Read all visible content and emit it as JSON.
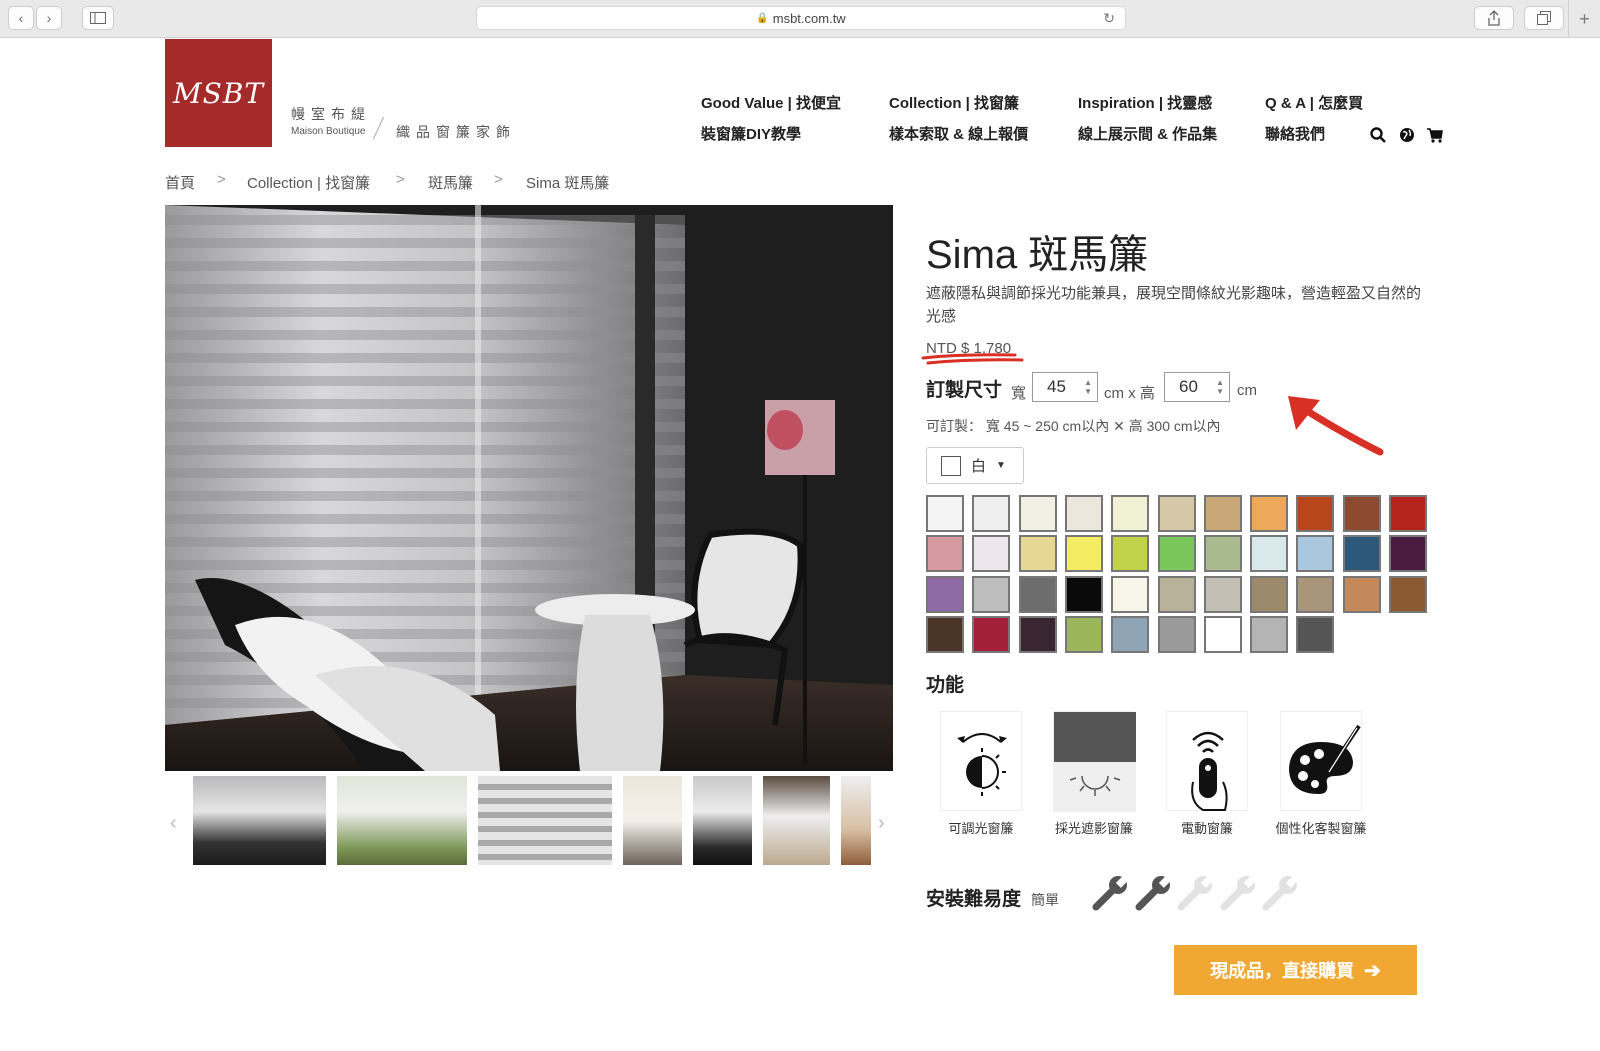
{
  "browser": {
    "url": "msbt.com.tw",
    "lock_icon": "🔒",
    "back": "‹",
    "forward": "›",
    "new_tab": "+"
  },
  "brand": {
    "logo_text": "MSBT",
    "name_cn": "幔室布緹",
    "name_en": "Maison Boutique",
    "tagline": "織品窗簾家飾"
  },
  "nav": {
    "row1": [
      "Good Value | 找便宜",
      "Collection | 找窗簾",
      "Inspiration | 找靈感",
      "Q & A | 怎麼買"
    ],
    "row2": [
      "裝窗簾DIY教學",
      "樣本索取 & 線上報價",
      "線上展示間 & 作品集",
      "聯絡我們"
    ]
  },
  "breadcrumb": [
    "首頁",
    "Collection | 找窗簾",
    "斑馬簾",
    "Sima 斑馬簾"
  ],
  "breadcrumb_sep": ">",
  "product": {
    "title": "Sima 斑馬簾",
    "description": "遮蔽隱私與調節採光功能兼具，展現空間條紋光影趣味，營造輕盈又自然的光感",
    "price": "NTD $ 1,780",
    "size_label": "訂製尺寸",
    "width_label": "寬",
    "width_value": "45",
    "cm_x_height": "cm x 高",
    "height_value": "60",
    "cm": "cm",
    "range": "可訂製： 寬 45 ~ 250 cm以內 ✕ 高 300 cm以內",
    "selected_color": "白"
  },
  "swatches": [
    "#f4f4f4",
    "#efefef",
    "#f1f0e4",
    "#ebe7dc",
    "#f0f1d4",
    "#d4c8a8",
    "#c9a777",
    "#eda95a",
    "#b8461b",
    "#8e4a31",
    "#b5241c",
    "#d89aa1",
    "#efe5ec",
    "#e6d795",
    "#f4ec62",
    "#bfd24a",
    "#79c75b",
    "#a9ba8e",
    "#d9e8ea",
    "#a9c8df",
    "#2d5879",
    "#4a1a3f",
    "#8e6ba4",
    "#bdbdbd",
    "#6d6d6d",
    "#0a0a0a",
    "#f7f6e8",
    "#b9b29b",
    "#c4bfb4",
    "#9d8a6c",
    "#a8957a",
    "#c4895a",
    "#8c5a32",
    "#4b3528",
    "#a31f3a",
    "#3a2533",
    "#9bb55b",
    "#8fa4b5",
    "#9a9a9a",
    "#ffffff",
    "#b4b4b4",
    "#555555"
  ],
  "features_title": "功能",
  "features": [
    "可調光窗簾",
    "採光遮影窗簾",
    "電動窗簾",
    "個性化客製窗簾"
  ],
  "difficulty": {
    "label": "安裝難易度",
    "level_text": "簡單",
    "level": 2,
    "max": 5
  },
  "buy_button": "現成品，直接購買",
  "colors": {
    "brand": "#a52a2a",
    "button": "#f0a833",
    "annotation": "#d93025"
  }
}
